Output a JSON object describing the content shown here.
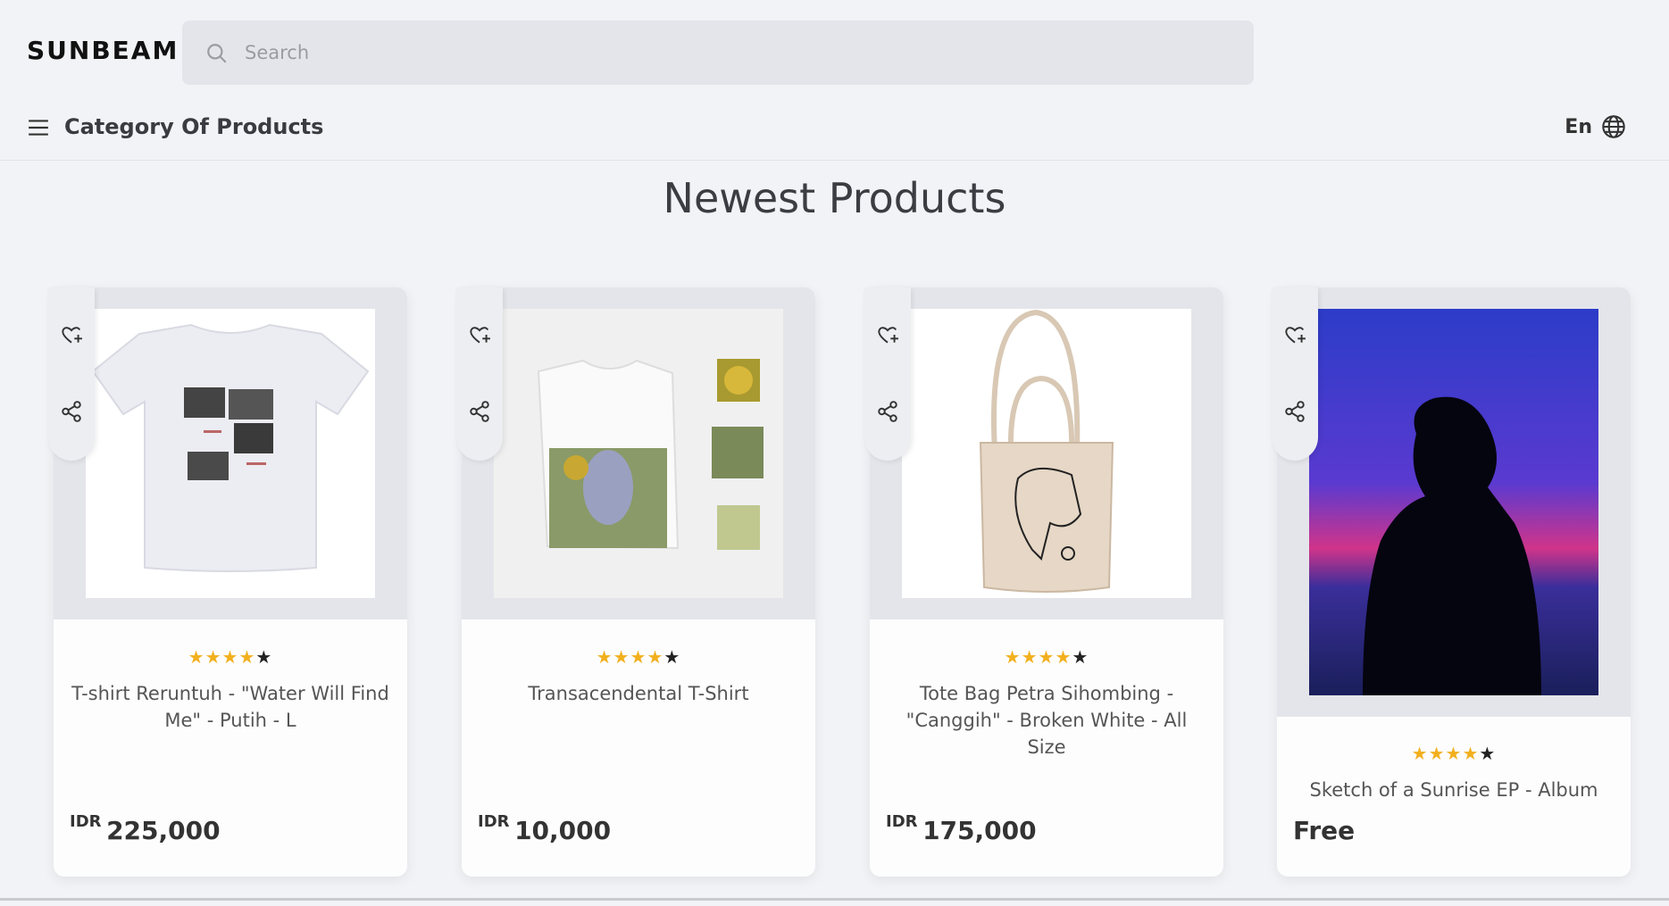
{
  "header": {
    "logo": "SUNBEAM",
    "search_placeholder": "Search"
  },
  "nav": {
    "category_label": "Category Of Products",
    "language": "En"
  },
  "section_title": "Newest Products",
  "colors": {
    "star_on": "#f2b01e",
    "star_off": "#222222",
    "card_media_bg": "#e4e5ea"
  },
  "products": [
    {
      "name": "T-shirt Reruntuh - \"Water Will Find Me\" - Putih - L",
      "rating": 4,
      "currency": "IDR",
      "price": "225,000",
      "image_icon": "white-tshirt-image"
    },
    {
      "name": "Transacendental T-Shirt",
      "rating": 4,
      "currency": "IDR",
      "price": "10,000",
      "image_icon": "tshirt-artwork-image"
    },
    {
      "name": "Tote Bag Petra Sihombing - \"Canggih\" - Broken White - All Size",
      "rating": 4,
      "currency": "IDR",
      "price": "175,000",
      "image_icon": "tote-bag-image"
    },
    {
      "name": "Sketch of a Sunrise EP - Album",
      "rating": 4,
      "currency": "",
      "price": "Free",
      "image_icon": "sunset-silhouette-image"
    }
  ]
}
